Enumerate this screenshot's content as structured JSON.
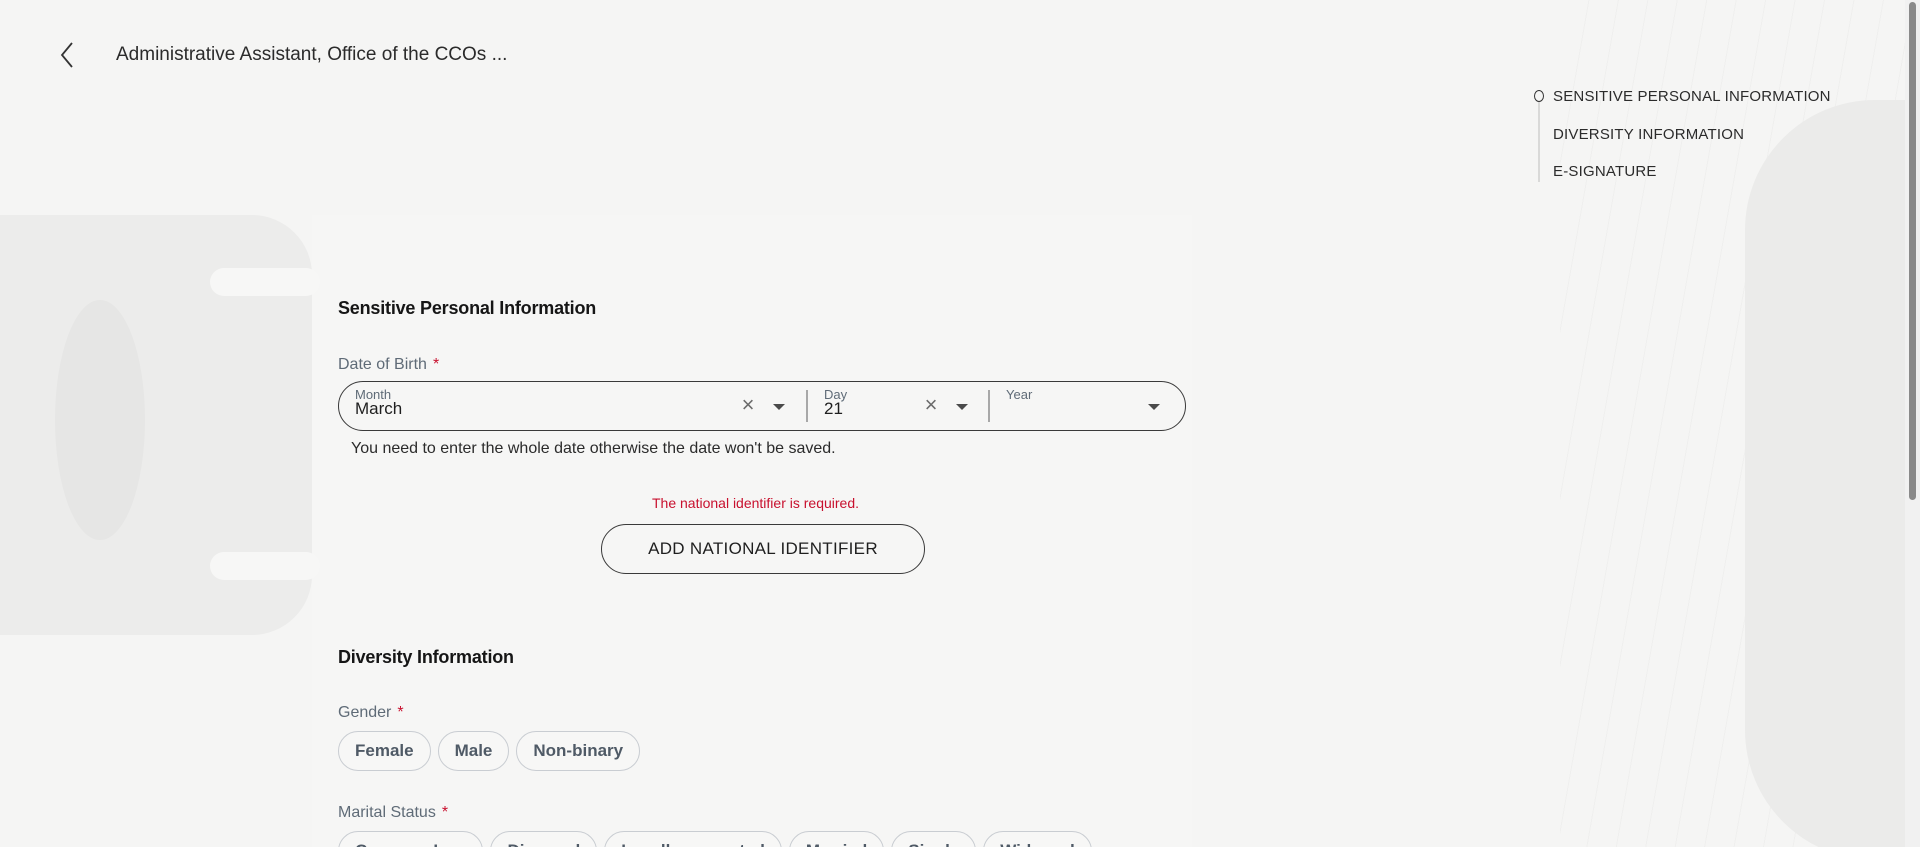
{
  "header": {
    "title": "Administrative Assistant, Office of the CCOs ..."
  },
  "side_nav": {
    "items": [
      {
        "label": "SENSITIVE PERSONAL INFORMATION"
      },
      {
        "label": "DIVERSITY INFORMATION"
      },
      {
        "label": "E-SIGNATURE"
      }
    ],
    "active_index": 0
  },
  "sensitive": {
    "heading": "Sensitive Personal Information",
    "dob": {
      "label": "Date of Birth",
      "required_mark": "*",
      "month": {
        "label": "Month",
        "value": "March"
      },
      "day": {
        "label": "Day",
        "value": "21"
      },
      "year": {
        "label": "Year",
        "value": ""
      },
      "hint": "You need to enter the whole date otherwise the date won't be saved."
    },
    "national_id": {
      "error": "The national identifier is required.",
      "button_label": "ADD NATIONAL IDENTIFIER"
    }
  },
  "diversity": {
    "heading": "Diversity Information",
    "gender": {
      "label": "Gender",
      "required_mark": "*",
      "options": [
        "Female",
        "Male",
        "Non-binary"
      ]
    },
    "marital_status": {
      "label": "Marital Status",
      "required_mark": "*",
      "options": [
        "Common Law",
        "Divorced",
        "Legally separated",
        "Married",
        "Single",
        "Widowed"
      ]
    }
  },
  "colors": {
    "error": "#c8102e",
    "background": "#f5f5f4",
    "label": "#5f6b77"
  }
}
